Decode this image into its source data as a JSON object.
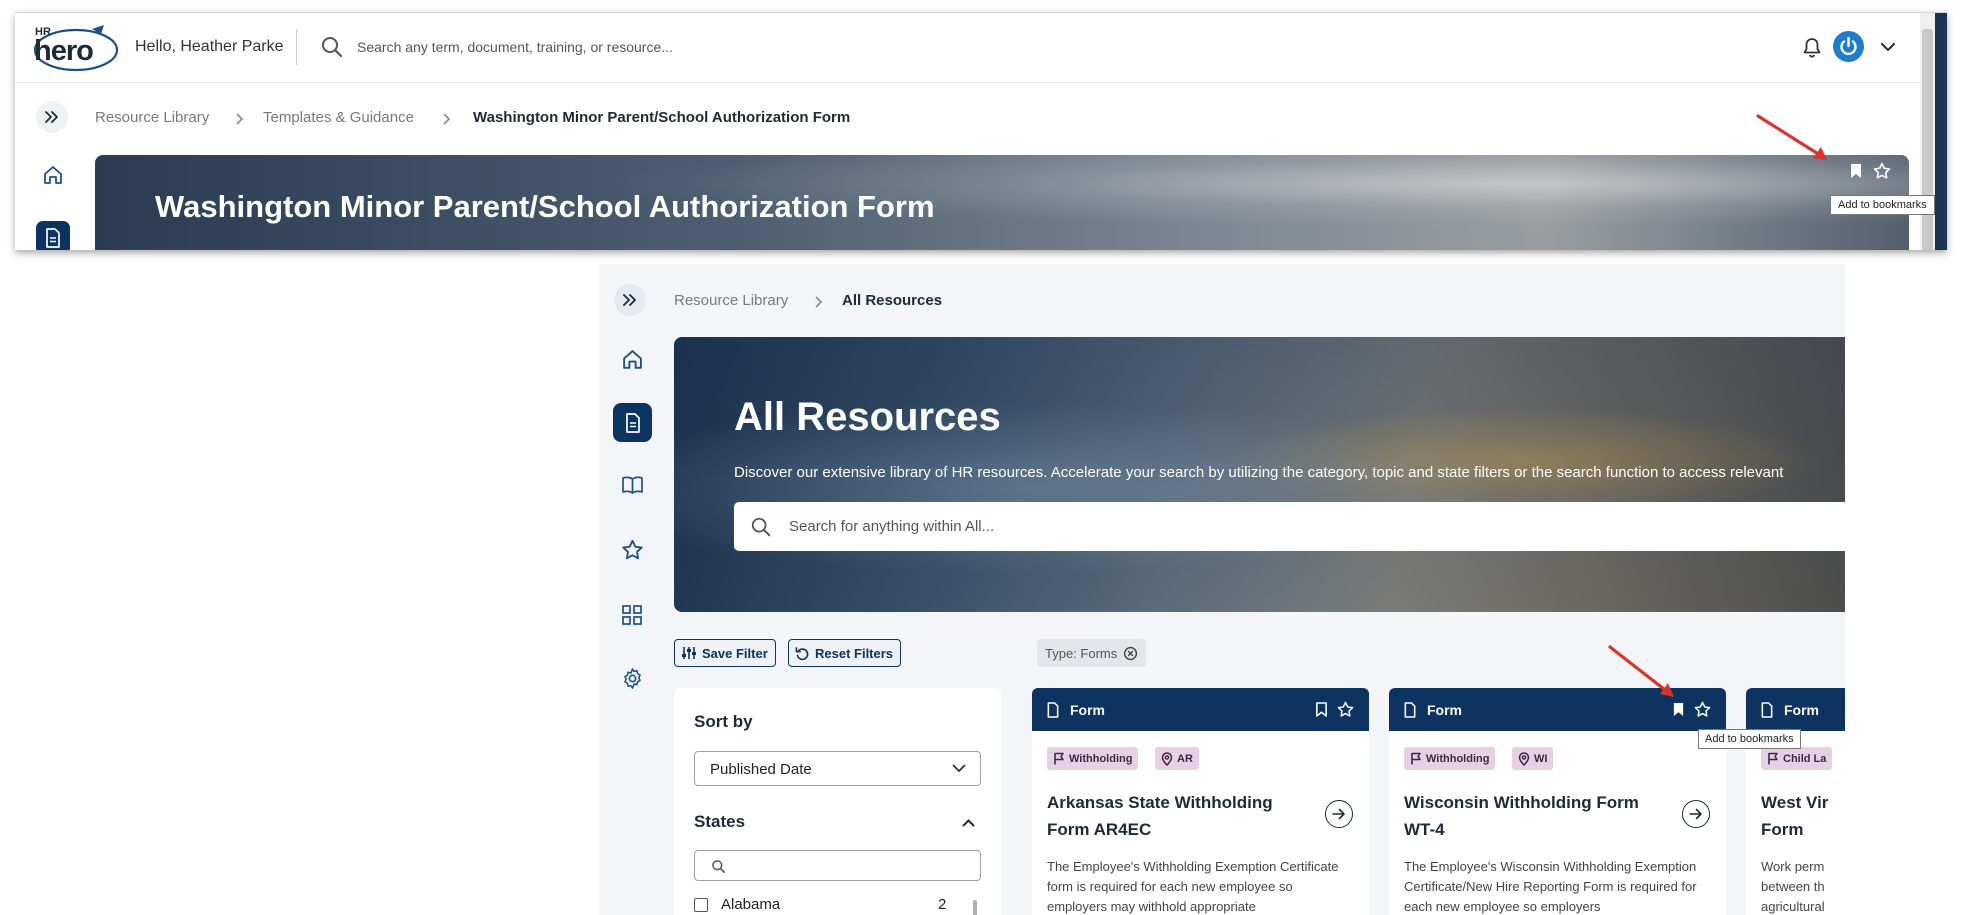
{
  "top": {
    "logo": {
      "superscript": "HR",
      "wordmark": "hero"
    },
    "greeting": "Hello, Heather Parke",
    "search_placeholder": "Search any term, document, training, or resource...",
    "breadcrumb": [
      "Resource Library",
      "Templates & Guidance",
      "Washington Minor Parent/School Authorization Form"
    ],
    "hero_title": "Washington Minor Parent/School Authorization Form",
    "tooltip": "Add to bookmarks"
  },
  "bottom": {
    "breadcrumb": [
      "Resource Library",
      "All Resources"
    ],
    "hero": {
      "title": "All Resources",
      "description": "Discover our extensive library of HR resources. Accelerate your search by utilizing the category, topic and state filters or the search function to access relevant",
      "search_placeholder": "Search for anything within All..."
    },
    "filters": {
      "save_label": "Save Filter",
      "reset_label": "Reset Filters",
      "active_chip": "Type: Forms"
    },
    "sort": {
      "label": "Sort by",
      "value": "Published Date",
      "states_label": "States",
      "state_rows": [
        {
          "name": "Alabama",
          "count": "2"
        }
      ]
    },
    "cards": [
      {
        "type": "Form",
        "tags": [
          {
            "label": "Withholding",
            "icon": "flag-icon"
          },
          {
            "label": "AR",
            "icon": "location-pin-icon"
          }
        ],
        "title": "Arkansas State Withholding Form AR4EC",
        "description": "The Employee's Withholding Exemption Certificate form is required for each new employee so employers may withhold appropriate"
      },
      {
        "type": "Form",
        "tags": [
          {
            "label": "Withholding",
            "icon": "flag-icon"
          },
          {
            "label": "WI",
            "icon": "location-pin-icon"
          }
        ],
        "title": "Wisconsin Withholding Form WT-4",
        "description": "The Employee's Wisconsin Withholding Exemption Certificate/New Hire Reporting Form is required for each new employee so employers"
      },
      {
        "type": "Form",
        "tags": [
          {
            "label": "Child La",
            "icon": "flag-icon"
          }
        ],
        "title": "West Vir Form",
        "description": "Work perm between th agricultural"
      }
    ],
    "tooltip": "Add to bookmarks"
  },
  "colors": {
    "navy": "#0d3360",
    "tag_bg": "#e7cfe4",
    "annotation_arrow": "#d9342b",
    "avatar_blue": "#1f7ec9"
  }
}
